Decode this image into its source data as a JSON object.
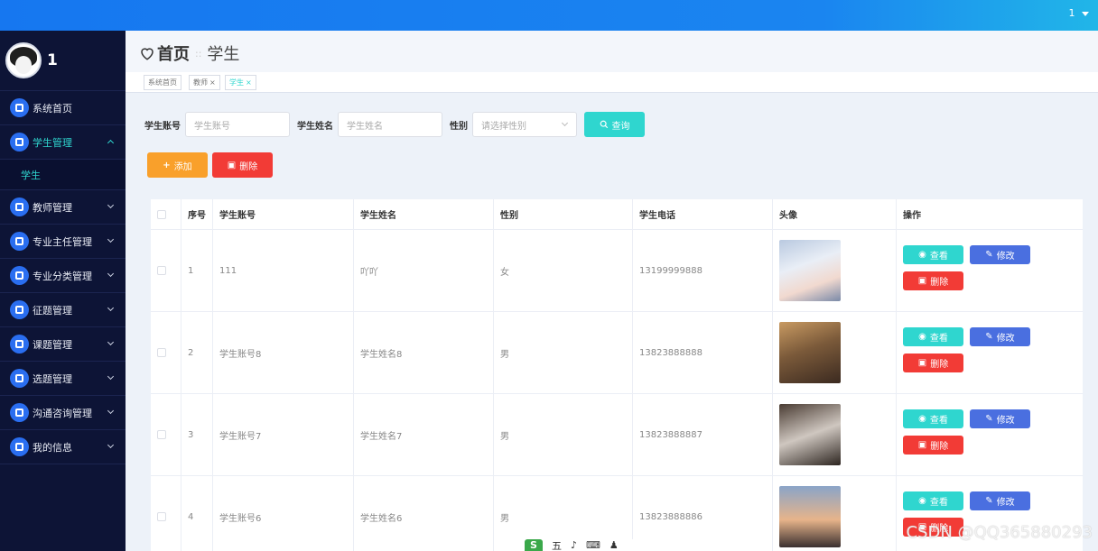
{
  "topbar": {
    "user": "1"
  },
  "sidebar": {
    "username": "1",
    "items": [
      {
        "label": "系统首页"
      },
      {
        "label": "学生管理",
        "expanded": true,
        "children": [
          {
            "label": "学生"
          }
        ]
      },
      {
        "label": "教师管理"
      },
      {
        "label": "专业主任管理"
      },
      {
        "label": "专业分类管理"
      },
      {
        "label": "征题管理"
      },
      {
        "label": "课题管理"
      },
      {
        "label": "选题管理"
      },
      {
        "label": "沟通咨询管理"
      },
      {
        "label": "我的信息"
      }
    ]
  },
  "header": {
    "home": "首页",
    "separator": "::",
    "current": "学生"
  },
  "tags": [
    {
      "label": "系统首页",
      "closable": false
    },
    {
      "label": "教师",
      "closable": true
    },
    {
      "label": "学生",
      "closable": true,
      "active": true
    }
  ],
  "tag_close": "×",
  "search": {
    "account_label": "学生账号",
    "account_placeholder": "学生账号",
    "name_label": "学生姓名",
    "name_placeholder": "学生姓名",
    "gender_label": "性别",
    "gender_placeholder": "请选择性别",
    "query_label": "查询"
  },
  "actions": {
    "add_label": "添加",
    "delete_label": "删除"
  },
  "table": {
    "headers": [
      "序号",
      "学生账号",
      "学生姓名",
      "性别",
      "学生电话",
      "头像",
      "操作"
    ],
    "rows": [
      {
        "index": "1",
        "account": "111",
        "name": "吖吖",
        "gender": "女",
        "phone": "13199999888"
      },
      {
        "index": "2",
        "account": "学生账号8",
        "name": "学生姓名8",
        "gender": "男",
        "phone": "13823888888"
      },
      {
        "index": "3",
        "account": "学生账号7",
        "name": "学生姓名7",
        "gender": "男",
        "phone": "13823888887"
      },
      {
        "index": "4",
        "account": "学生账号6",
        "name": "学生姓名6",
        "gender": "男",
        "phone": "13823888886"
      }
    ],
    "row_actions": {
      "view": "查看",
      "edit": "修改",
      "delete": "删除"
    }
  },
  "watermark": "CSDN @QQ365880293",
  "floatbar": {
    "logo": "S",
    "items": [
      "五",
      "♪",
      "⌨",
      "♟"
    ]
  },
  "colors": {
    "accent": "#2fd6cf",
    "primary": "#4a6fe0",
    "danger": "#f23b36",
    "warning": "#f9a02b",
    "sidebar": "#0d1436"
  }
}
